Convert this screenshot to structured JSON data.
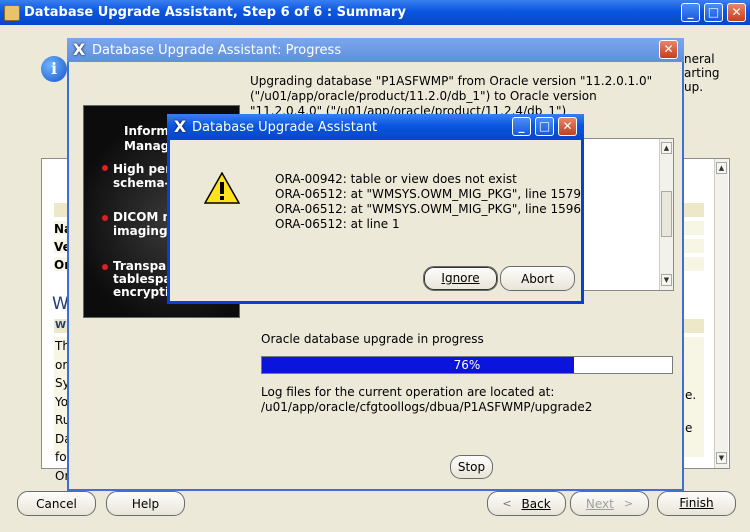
{
  "main_window": {
    "title": "Database Upgrade Assistant, Step 6 of 6 : Summary",
    "info_text_lines": [
      "neral",
      "arting",
      "up."
    ],
    "list_fragments": [
      "Na",
      "Ve",
      "Or",
      "W",
      "W",
      "Th",
      "or",
      "Sy",
      "Yo",
      "Ru",
      "Da",
      "fo",
      "Or"
    ],
    "right_fragments": [
      "e.",
      "e"
    ],
    "buttons": {
      "cancel": "Cancel",
      "help": "Help",
      "back": "Back",
      "next": "Next",
      "finish": "Finish"
    }
  },
  "progress_dialog": {
    "title": "Database Upgrade Assistant: Progress",
    "message_lines": [
      "Upgrading database \"P1ASFWMP\" from Oracle version \"11.2.0.1.0\"",
      "(\"/u01/app/oracle/product/11.2.0/db_1\") to Oracle version",
      "\"11.2.0.4.0\" (\"/u01/app/oracle/product/11.2.4/db_1\")"
    ],
    "feature_panel": {
      "heading_lines": [
        "Information",
        "Management"
      ],
      "bullets": [
        [
          "High performance",
          "schema-less"
        ],
        [
          "DICOM medical",
          "imaging"
        ],
        [
          "Transparent",
          "tablespace",
          "encryption"
        ]
      ]
    },
    "status_label": "Oracle database upgrade in progress",
    "progress": {
      "value": 76,
      "label": "76%"
    },
    "log_label": "Log files for the current operation are located at:",
    "log_path": "/u01/app/oracle/cfgtoollogs/dbua/P1ASFWMP/upgrade2",
    "stop_button": "Stop"
  },
  "error_dialog": {
    "title": "Database Upgrade Assistant",
    "icon": "warning-icon",
    "lines": [
      "ORA-00942: table or view does not exist",
      "ORA-06512: at \"WMSYS.OWM_MIG_PKG\", line 1579",
      "ORA-06512: at \"WMSYS.OWM_MIG_PKG\", line 1596",
      "ORA-06512: at line 1"
    ],
    "ignore_button": "Ignore",
    "abort_button": "Abort"
  },
  "colors": {
    "titlebar": "#0a55e0",
    "progress_fill": "#0a14dc",
    "window_bg": "#ece9d8",
    "list_header": "#ece8c8"
  }
}
